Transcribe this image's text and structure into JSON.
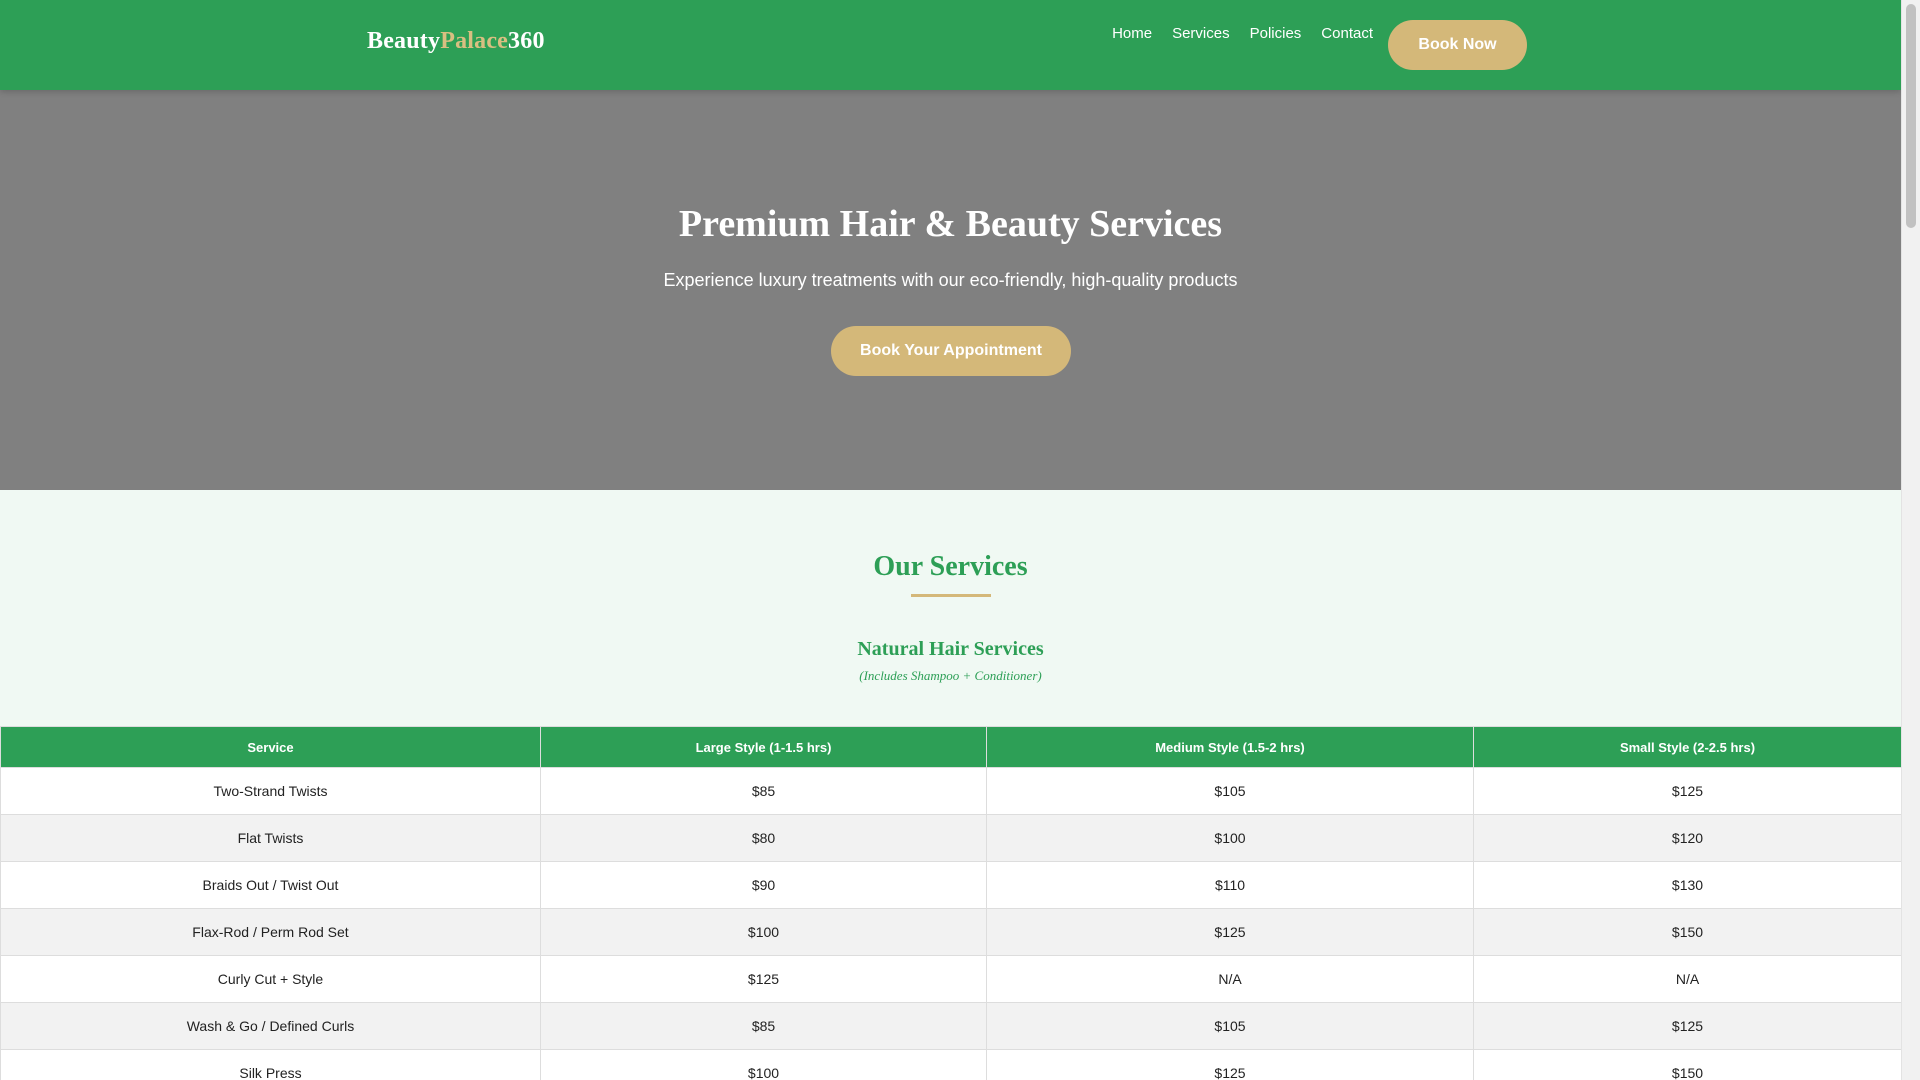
{
  "header": {
    "logo_part1": "Beauty",
    "logo_part2": "Palace",
    "logo_part3": "360",
    "nav": [
      "Home",
      "Services",
      "Policies",
      "Contact"
    ],
    "book_now": "Book Now"
  },
  "hero": {
    "title": "Premium Hair & Beauty Services",
    "subtitle": "Experience luxury treatments with our eco-friendly, high-quality products",
    "cta": "Book Your Appointment"
  },
  "services": {
    "title": "Our Services",
    "category_title": "Natural Hair Services",
    "category_note": "(Includes Shampoo + Conditioner)",
    "columns": [
      "Service",
      "Large Style (1-1.5 hrs)",
      "Medium Style (1.5-2 hrs)",
      "Small Style (2-2.5 hrs)"
    ],
    "rows": [
      [
        "Two-Strand Twists",
        "$85",
        "$105",
        "$125"
      ],
      [
        "Flat Twists",
        "$80",
        "$100",
        "$120"
      ],
      [
        "Braids Out / Twist Out",
        "$90",
        "$110",
        "$130"
      ],
      [
        "Flax-Rod / Perm Rod Set",
        "$100",
        "$125",
        "$150"
      ],
      [
        "Curly Cut + Style",
        "$125",
        "N/A",
        "N/A"
      ],
      [
        "Wash & Go / Defined Curls",
        "$85",
        "$105",
        "$125"
      ],
      [
        "Silk Press",
        "$100",
        "$125",
        "$150"
      ]
    ]
  },
  "colors": {
    "brand_green": "#2d9f56",
    "accent_gold": "#d4b879",
    "hero_gray": "#808080"
  }
}
